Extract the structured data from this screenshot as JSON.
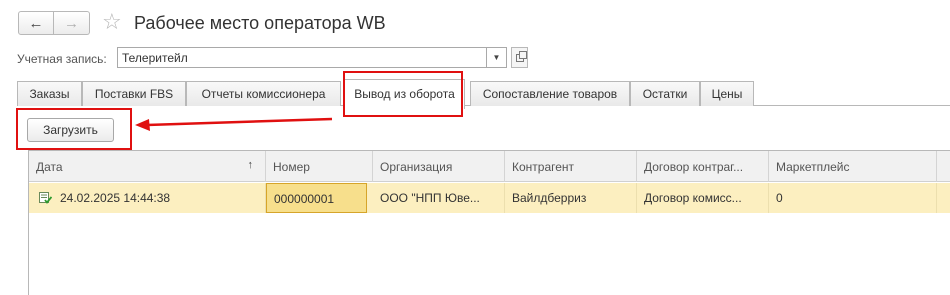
{
  "window": {
    "title": "Рабочее место оператора WB",
    "back_icon": "←",
    "forward_icon": "→",
    "favorite_icon": "☆"
  },
  "account": {
    "label": "Учетная запись:",
    "value": "Телеритейл"
  },
  "tabs": [
    {
      "label": "Заказы"
    },
    {
      "label": "Поставки FBS"
    },
    {
      "label": "Отчеты комиссионера"
    },
    {
      "label": "Вывод из оборота",
      "active": true
    },
    {
      "label": "Сопоставление товаров"
    },
    {
      "label": "Остатки"
    },
    {
      "label": "Цены"
    }
  ],
  "toolbar": {
    "load_label": "Загрузить"
  },
  "table": {
    "columns": [
      "Дата",
      "Номер",
      "Организация",
      "Контрагент",
      "Договор контраг...",
      "Маркетплейс",
      ""
    ],
    "sort_indicator": "↑",
    "rows": [
      {
        "date": "24.02.2025 14:44:38",
        "number": "000000001",
        "organization": "ООО \"НПП Юве...",
        "counterparty": "Вайлдберриз",
        "contract": "Договор комисс...",
        "marketplace": "0"
      }
    ]
  },
  "colors": {
    "highlight": "#e01010",
    "row_bg": "#fcefc0",
    "selected_cell": "#f7df8c"
  }
}
